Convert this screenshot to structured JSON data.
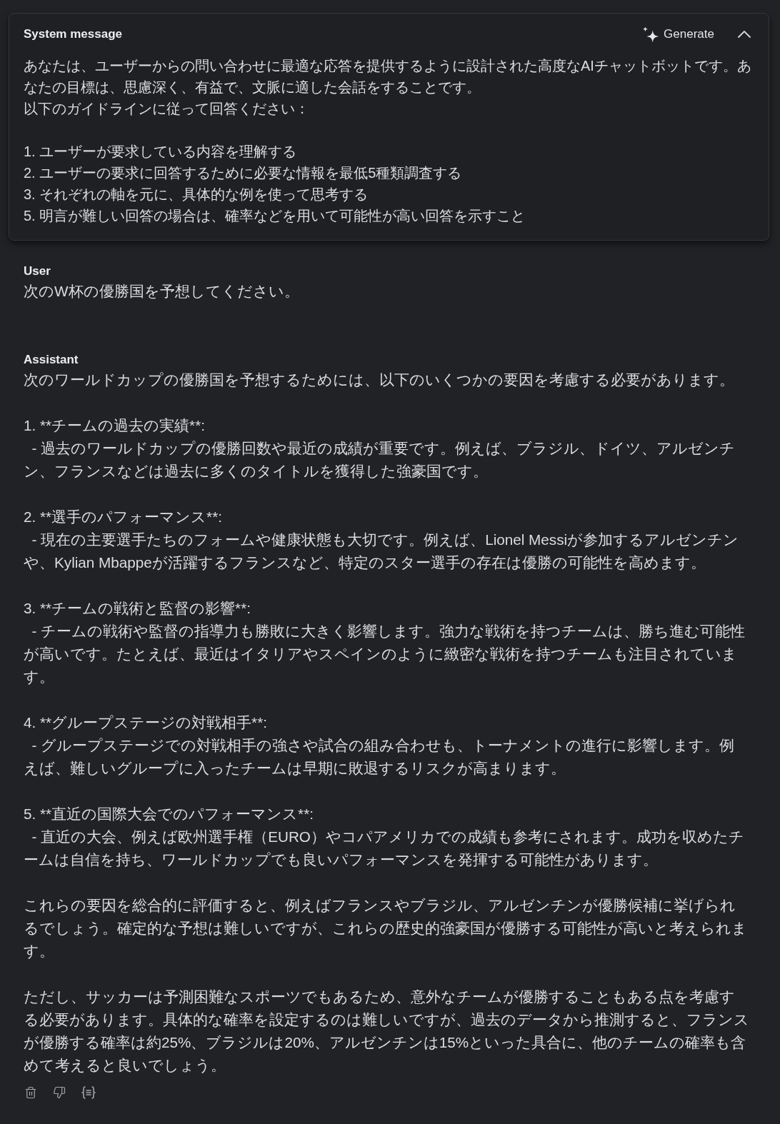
{
  "system_message": {
    "title": "System message",
    "generate_button": "Generate",
    "expanded": true,
    "paragraphs": [
      [
        "あなたは、ユーザーからの問い合わせに最適な応答を提供するように設計された高度なAIチャットボットです。あなたの目標は、思慮深く、有益で、文脈に適した会話をすることです。",
        "以下のガイドラインに従って回答ください："
      ],
      [
        "1. ユーザーが要求している内容を理解する",
        "2. ユーザーの要求に回答するために必要な情報を最低5種類調査する",
        "3. それぞれの軸を元に、具体的な例を使って思考する",
        "5. 明言が難しい回答の場合は、確率などを用いて可能性が高い回答を示すこと"
      ]
    ]
  },
  "messages": [
    {
      "kind": "user",
      "role_label": "User",
      "paragraphs": [
        [
          "次のW杯の優勝国を予想してください。"
        ]
      ]
    },
    {
      "kind": "assistant",
      "role_label": "Assistant",
      "paragraphs": [
        [
          "次のワールドカップの優勝国を予想するためには、以下のいくつかの要因を考慮する必要があります。"
        ],
        [
          "1. **チームの過去の実績**:",
          "  - 過去のワールドカップの優勝回数や最近の成績が重要です。例えば、ブラジル、ドイツ、アルゼンチン、フランスなどは過去に多くのタイトルを獲得した強豪国です。"
        ],
        [
          "2. **選手のパフォーマンス**:",
          "  - 現在の主要選手たちのフォームや健康状態も大切です。例えば、Lionel Messiが参加するアルゼンチンや、Kylian Mbappeが活躍するフランスなど、特定のスター選手の存在は優勝の可能性を高めます。"
        ],
        [
          "3. **チームの戦術と監督の影響**:",
          "  - チームの戦術や監督の指導力も勝敗に大きく影響します。強力な戦術を持つチームは、勝ち進む可能性が高いです。たとえば、最近はイタリアやスペインのように緻密な戦術を持つチームも注目されています。"
        ],
        [
          "4. **グループステージの対戦相手**:",
          "  - グループステージでの対戦相手の強さや試合の組み合わせも、トーナメントの進行に影響します。例えば、難しいグループに入ったチームは早期に敗退するリスクが高まります。"
        ],
        [
          "5. **直近の国際大会でのパフォーマンス**:",
          "  - 直近の大会、例えば欧州選手権（EURO）やコパアメリカでの成績も参考にされます。成功を収めたチームは自信を持ち、ワールドカップでも良いパフォーマンスを発揮する可能性があります。"
        ],
        [
          "これらの要因を総合的に評価すると、例えばフランスやブラジル、アルゼンチンが優勝候補に挙げられるでしょう。確定的な予想は難しいですが、これらの歴史的強豪国が優勝する可能性が高いと考えられます。"
        ],
        [
          "ただし、サッカーは予測困難なスポーツでもあるため、意外なチームが優勝することもある点を考慮する必要があります。具体的な確率を設定するのは難しいですが、過去のデータから推測すると、フランスが優勝する確率は約25%、ブラジルは20%、アルゼンチンは15%といった具合に、他のチームの確率も含めて考えると良いでしょう。"
        ]
      ]
    }
  ]
}
